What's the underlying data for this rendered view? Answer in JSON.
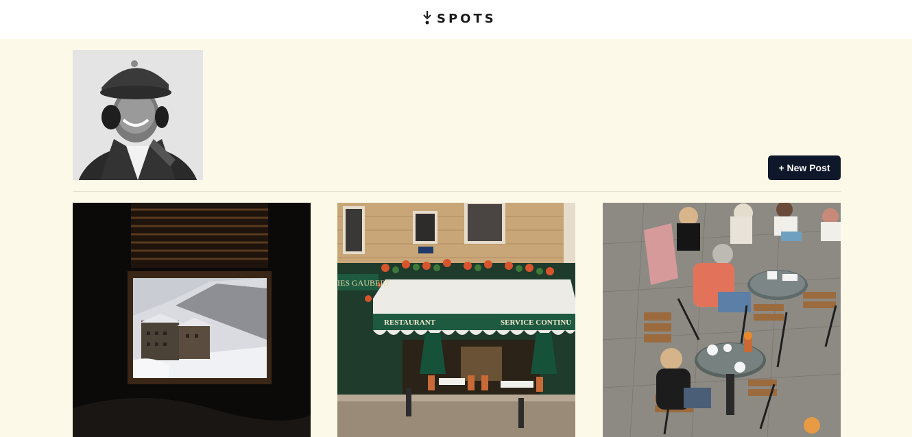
{
  "header": {
    "logo_text": "SPOTS",
    "logo_icon": "fork-drop-icon"
  },
  "profile": {
    "avatar_icon": "profile-photo"
  },
  "toolbar": {
    "new_post_label": "+ New Post"
  },
  "posts": [
    {
      "image": "window-snowy-mountain-photo"
    },
    {
      "image": "paris-restaurant-facade-photo",
      "signs": {
        "restaurant": "RESTAURANT",
        "service": "SERVICE CONTINU",
        "name": "IES GAUBERT"
      }
    },
    {
      "image": "outdoor-cafe-tables-photo"
    }
  ],
  "colors": {
    "background": "#fdf9e8",
    "header_bg": "#ffffff",
    "button_bg": "#0f172a",
    "button_text": "#ffffff"
  }
}
